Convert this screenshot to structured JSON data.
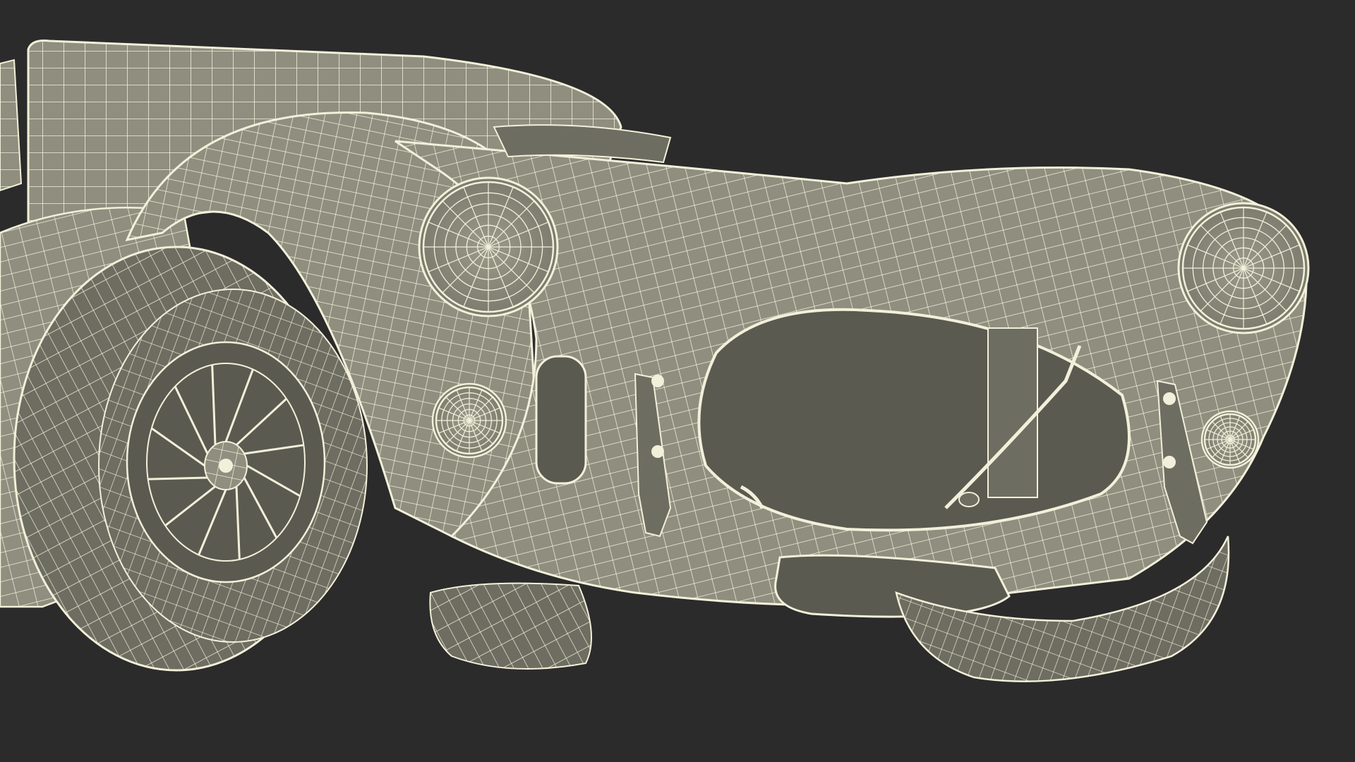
{
  "scene": {
    "subject": "wireframe-car-front",
    "background_color": "#2b2b2b",
    "body_color": "#8f8e7f",
    "body_shade_color": "#6e6d61",
    "cavity_color": "#5b5a50",
    "wire_color": "#f2f0da"
  }
}
